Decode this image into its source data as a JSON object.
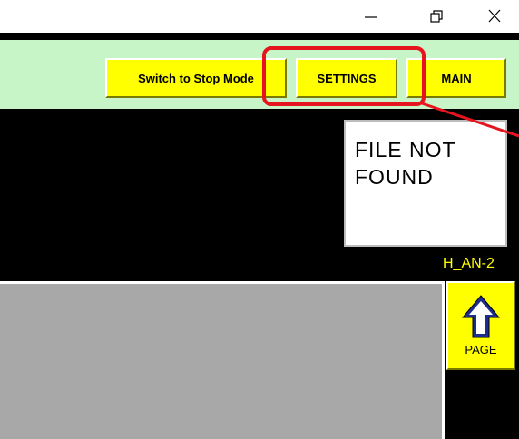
{
  "window_controls": {
    "minimize_icon": "minimize-icon",
    "restore_icon": "restore-icon",
    "close_icon": "close-icon"
  },
  "toolbar": {
    "switch_label": "Switch to Stop Mode",
    "settings_label": "SETTINGS",
    "main_label": "MAIN"
  },
  "file_status": {
    "text": "FILE NOT\nFOUND"
  },
  "screen_id": "H_AN-2",
  "page_button": {
    "label": "PAGE",
    "icon": "up-arrow-icon"
  },
  "colors": {
    "toolbar_bg": "#c8f5c8",
    "button_yellow": "#ffff00",
    "highlight_red": "#e6141e",
    "tag_yellow": "#ffff00",
    "panel_grey": "#a8a8a8"
  }
}
